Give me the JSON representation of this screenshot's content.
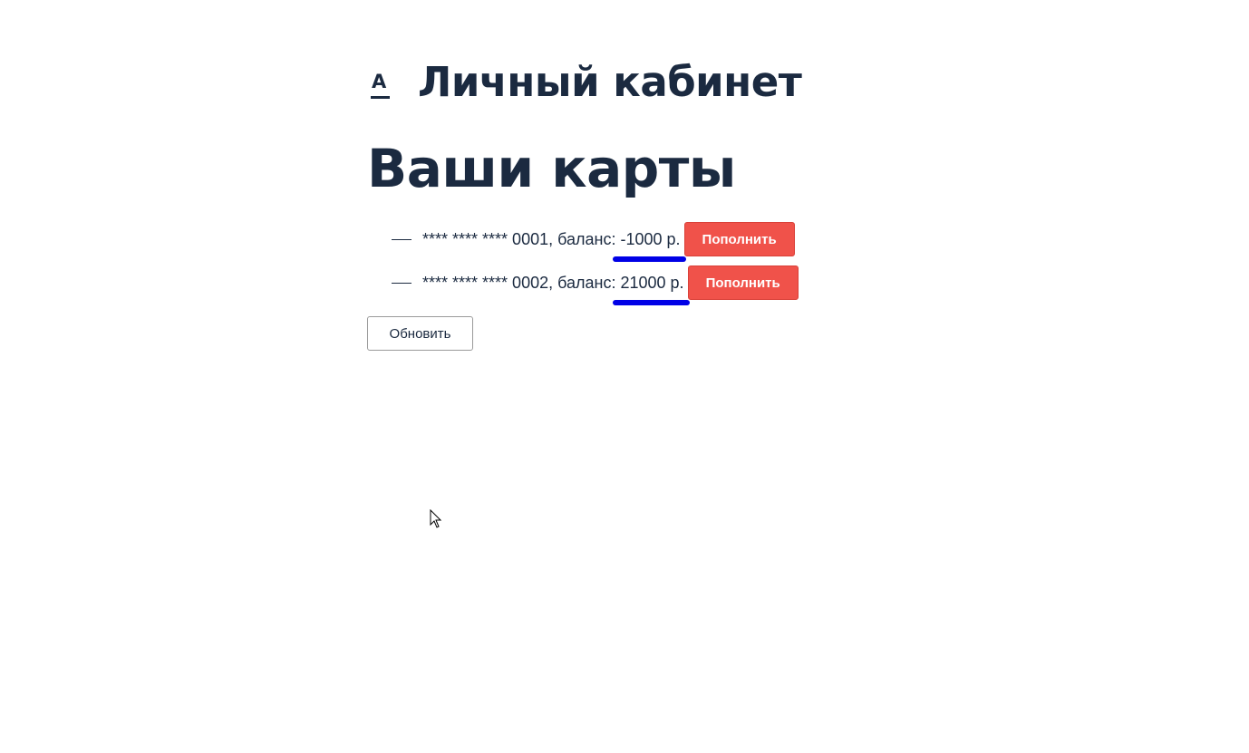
{
  "header": {
    "logo_letter": "A",
    "title": "Личный кабинет"
  },
  "section": {
    "title": "Ваши карты"
  },
  "cards": [
    {
      "number": "**** **** **** 0001",
      "separator": ", баланс: ",
      "balance": "-1000",
      "currency": " р.",
      "topup_label": "Пополнить"
    },
    {
      "number": "**** **** **** 0002",
      "separator": ", баланс: ",
      "balance": "21000",
      "currency": " р.",
      "topup_label": "Пополнить"
    }
  ],
  "actions": {
    "refresh_label": "Обновить"
  },
  "colors": {
    "text": "#1b2a40",
    "topup_button": "#f0524a",
    "annotation_underline": "#0000e6"
  },
  "icons": {
    "logo": "bank-logo-icon",
    "cursor": "mouse-cursor-icon"
  }
}
